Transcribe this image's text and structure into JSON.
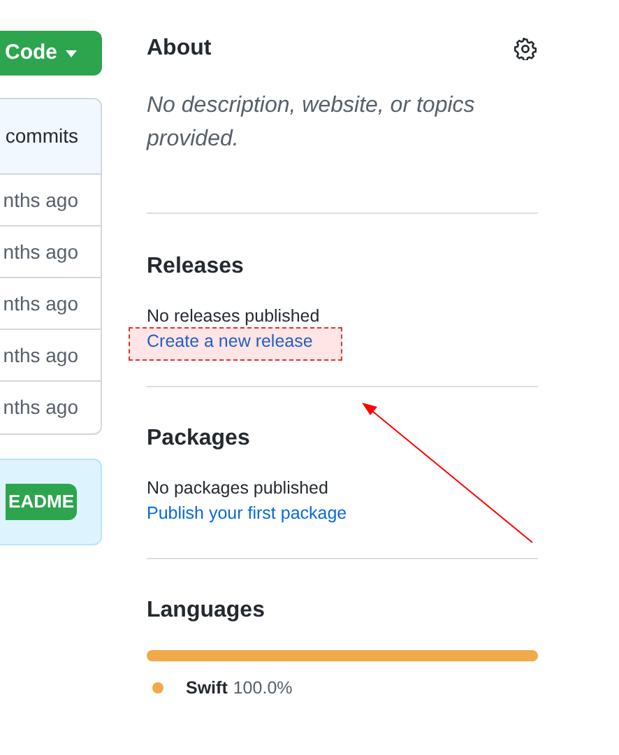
{
  "code_button": {
    "label": "Code"
  },
  "commits_box": {
    "header": "commits",
    "rows": [
      "nths ago",
      "nths ago",
      "nths ago",
      "nths ago",
      "nths ago"
    ]
  },
  "readme_box": {
    "button": "EADME"
  },
  "about": {
    "title": "About",
    "description": "No description, website, or topics provided."
  },
  "releases": {
    "title": "Releases",
    "text": "No releases published",
    "link": "Create a new release"
  },
  "packages": {
    "title": "Packages",
    "text": "No packages published",
    "link": "Publish your first package"
  },
  "languages": {
    "title": "Languages",
    "items": [
      {
        "name": "Swift",
        "percent": "100.0%",
        "color": "#f1a94a",
        "level": 1
      }
    ]
  },
  "annotations": {
    "highlight": true,
    "arrow": true
  }
}
